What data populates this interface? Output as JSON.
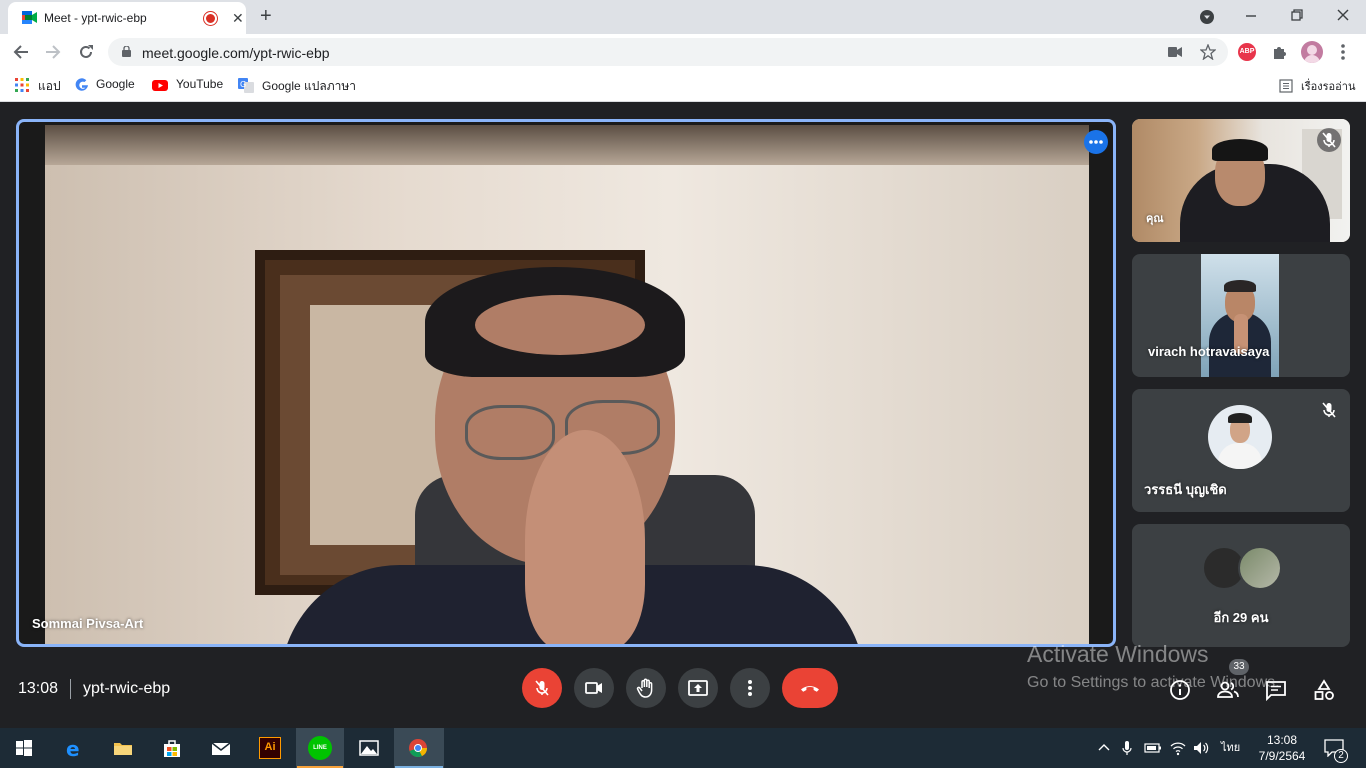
{
  "browser": {
    "tab_title": "Meet - ypt-rwic-ebp",
    "tab_close": "✕",
    "new_tab": "+",
    "url": "meet.google.com/ypt-rwic-ebp",
    "bookmarks": [
      {
        "label": "แอป",
        "icon": "apps-grid-icon"
      },
      {
        "label": "Google",
        "icon": "google-g-icon"
      },
      {
        "label": "YouTube",
        "icon": "youtube-icon"
      },
      {
        "label": "Google แปลภาษา",
        "icon": "google-translate-icon"
      }
    ],
    "reading_list": "เรื่องรออ่าน",
    "extensions": {
      "abp": "ABP"
    }
  },
  "meet": {
    "main_speaker": "Sommai Pivsa-Art",
    "participants": [
      {
        "name": "คุณ",
        "muted": true
      },
      {
        "name": "virach hotravaisaya",
        "muted": false
      },
      {
        "name": "วรรธนี บุญเชิด",
        "muted": true
      },
      {
        "name": "อีก 29 คน",
        "muted": false
      }
    ],
    "time": "13:08",
    "meeting_code": "ypt-rwic-ebp",
    "people_count": "33",
    "colors": {
      "hangup": "#ea4335",
      "active_border": "#8ab4f8",
      "background": "#202124"
    }
  },
  "watermark": {
    "line1": "Activate Windows",
    "line2": "Go to Settings to activate Windows."
  },
  "taskbar": {
    "apps": [
      "windows-start",
      "edge",
      "file-explorer",
      "store",
      "mail",
      "illustrator",
      "line",
      "photos",
      "chrome"
    ],
    "illustrator_label": "Ai",
    "line_label": "LINE",
    "language": "ไทย",
    "time": "13:08",
    "date": "7/9/2564",
    "notifications": "2"
  }
}
